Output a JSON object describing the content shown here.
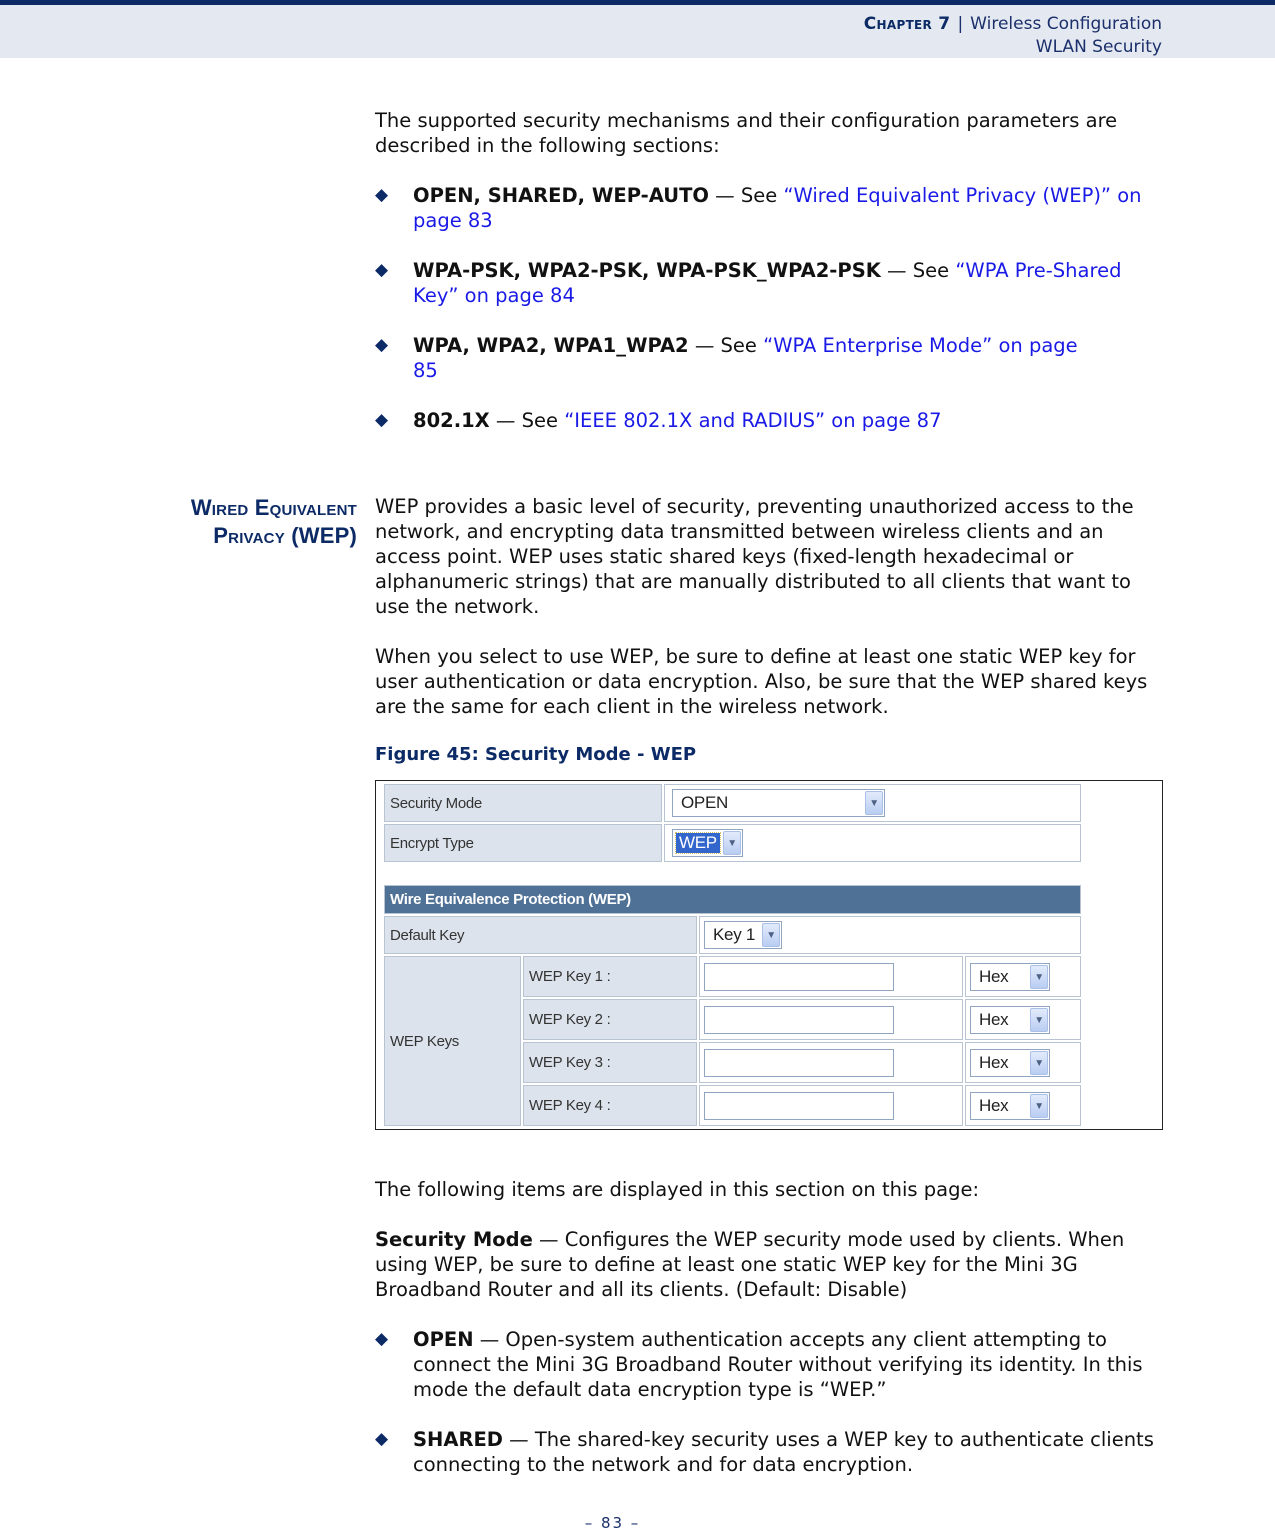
{
  "header": {
    "chapter_label": "Chapter 7",
    "separator": "|",
    "chapter_title": "Wireless Configuration",
    "section_title": "WLAN Security"
  },
  "intro": {
    "paragraph": "The supported security mechanisms and their configuration parameters are described in the following sections:",
    "bullets": [
      {
        "term": "OPEN, SHARED, WEP-AUTO",
        "dash": " — See ",
        "link": "“Wired Equivalent Privacy (WEP)” on page 83"
      },
      {
        "term": "WPA-PSK, WPA2-PSK, WPA-PSK_WPA2-PSK",
        "dash": " — See ",
        "link": "“WPA Pre-Shared Key” on page 84"
      },
      {
        "term": "WPA, WPA2, WPA1_WPA2",
        "dash": " — See ",
        "link": "“WPA Enterprise Mode” on page 85"
      },
      {
        "term": "802.1X",
        "dash": " — See ",
        "link": "“IEEE 802.1X and RADIUS” on page 87"
      }
    ]
  },
  "section": {
    "heading_line1": "Wired Equivalent",
    "heading_line2": "Privacy (WEP)",
    "paragraph1": "WEP provides a basic level of security, preventing unauthorized access to the network, and encrypting data transmitted between wireless clients and an access point. WEP uses static shared keys (fixed-length hexadecimal or alphanumeric strings) that are manually distributed to all clients that want to use the network.",
    "paragraph2": "When you select to use WEP, be sure to define at least one static WEP key for user authentication or data encryption. Also, be sure that the WEP shared keys are the same for each client in the wireless network."
  },
  "figure": {
    "caption": "Figure 45:  Security Mode - WEP",
    "security_mode_label": "Security Mode",
    "security_mode_value": "OPEN",
    "encrypt_type_label": "Encrypt Type",
    "encrypt_type_value": "WEP",
    "wep_banner": "Wire Equivalence Protection (WEP)",
    "default_key_label": "Default Key",
    "default_key_value": "Key 1",
    "wep_keys_label": "WEP Keys",
    "keys": [
      {
        "label": "WEP Key 1 :",
        "value": "",
        "format": "Hex"
      },
      {
        "label": "WEP Key 2 :",
        "value": "",
        "format": "Hex"
      },
      {
        "label": "WEP Key 3 :",
        "value": "",
        "format": "Hex"
      },
      {
        "label": "WEP Key 4 :",
        "value": "",
        "format": "Hex"
      }
    ],
    "dropdown_icon": "chevron-down-icon"
  },
  "items": {
    "intro": "The following items are displayed in this section on this page:",
    "security_mode_term": "Security Mode",
    "security_mode_desc": " — Configures the WEP security mode used by clients. When using WEP, be sure to define at least one static WEP key for the Mini 3G Broadband Router and all its clients. (Default: Disable)",
    "bullets": [
      {
        "term": "OPEN",
        "desc": " — Open-system authentication accepts any client attempting to connect the Mini 3G Broadband Router without verifying its identity. In this mode the default data encryption type is “WEP.”"
      },
      {
        "term": "SHARED",
        "desc": " — The shared-key security uses a WEP key to authenticate clients connecting to the network and for data encryption."
      }
    ]
  },
  "footer": {
    "page_number": "–  83  –"
  },
  "colors": {
    "brand_navy": "#0b2a66",
    "link_blue": "#1a1ae6",
    "header_band": "#e4e8f0",
    "ui_label_bg": "#dde3ec",
    "ui_banner_bg": "#4f7196"
  }
}
